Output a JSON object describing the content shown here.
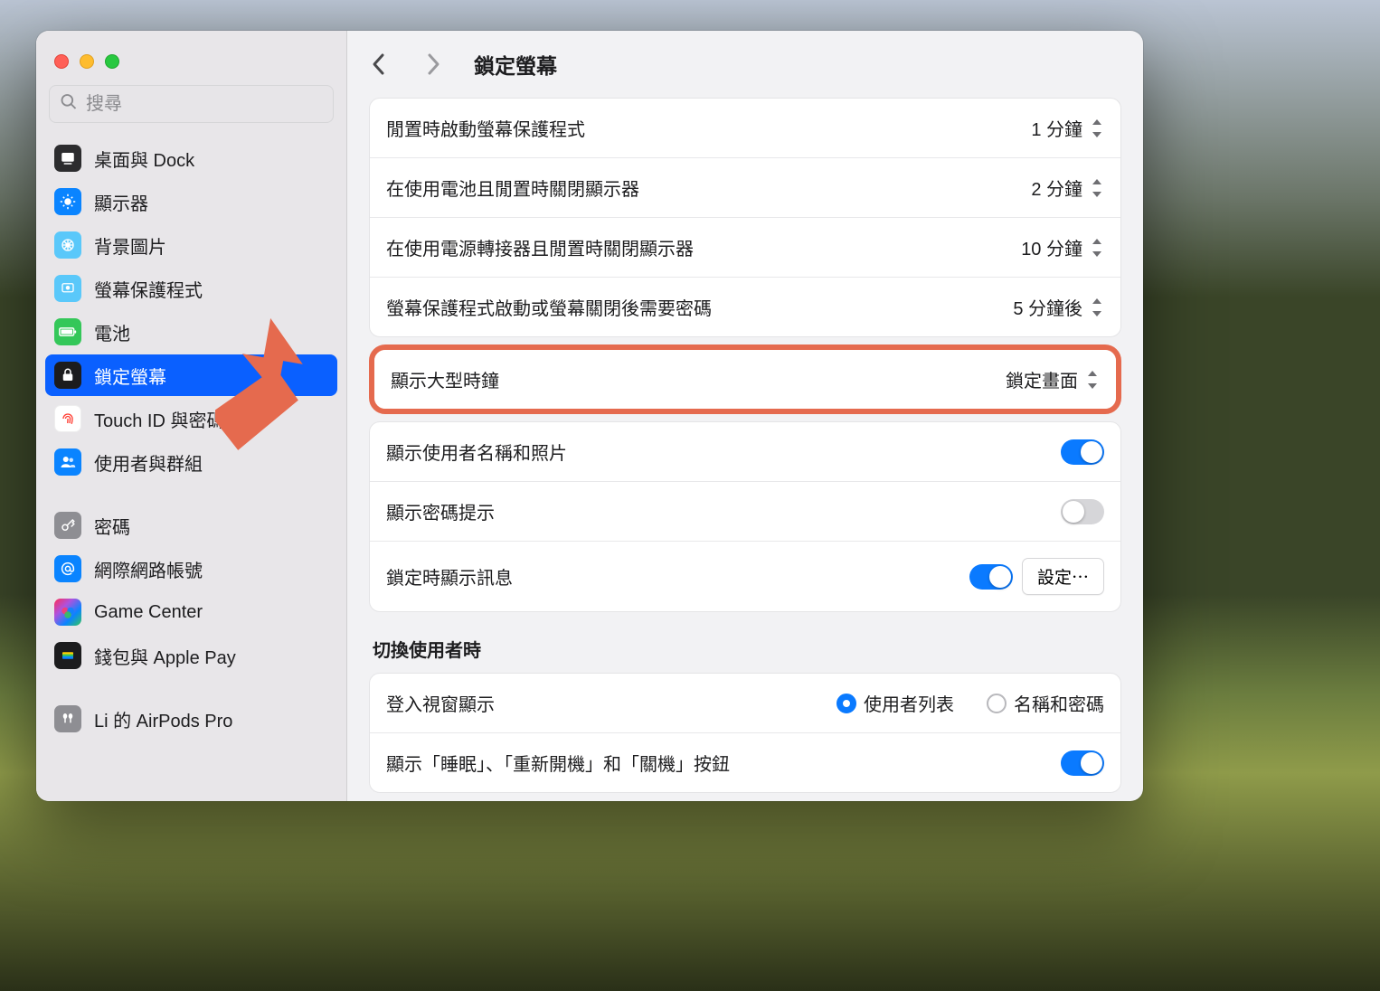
{
  "search": {
    "placeholder": "搜尋"
  },
  "sidebar": {
    "items": [
      {
        "label": "桌面與 Dock"
      },
      {
        "label": "顯示器"
      },
      {
        "label": "背景圖片"
      },
      {
        "label": "螢幕保護程式"
      },
      {
        "label": "電池"
      },
      {
        "label": "鎖定螢幕"
      },
      {
        "label": "Touch ID 與密碼"
      },
      {
        "label": "使用者與群組"
      },
      {
        "label": "密碼"
      },
      {
        "label": "網際網路帳號"
      },
      {
        "label": "Game Center"
      },
      {
        "label": "錢包與 Apple Pay"
      },
      {
        "label": "Li 的 AirPods Pro"
      }
    ]
  },
  "header": {
    "title": "鎖定螢幕"
  },
  "rows": {
    "screensaver_idle": {
      "label": "閒置時啟動螢幕保護程式",
      "value": "1 分鐘"
    },
    "battery_display_off": {
      "label": "在使用電池且閒置時關閉顯示器",
      "value": "2 分鐘"
    },
    "power_display_off": {
      "label": "在使用電源轉接器且閒置時關閉顯示器",
      "value": "10 分鐘"
    },
    "require_password": {
      "label": "螢幕保護程式啟動或螢幕關閉後需要密碼",
      "value": "5 分鐘後"
    },
    "large_clock": {
      "label": "顯示大型時鐘",
      "value": "鎖定畫面"
    },
    "show_user_photo": {
      "label": "顯示使用者名稱和照片"
    },
    "show_password_hint": {
      "label": "顯示密碼提示"
    },
    "show_message": {
      "label": "鎖定時顯示訊息",
      "button": "設定⋯"
    }
  },
  "section2": {
    "title": "切換使用者時",
    "login_window": {
      "label": "登入視窗顯示",
      "opt1": "使用者列表",
      "opt2": "名稱和密碼"
    },
    "show_buttons": {
      "label": "顯示「睡眠」、「重新開機」和「關機」按鈕"
    }
  }
}
